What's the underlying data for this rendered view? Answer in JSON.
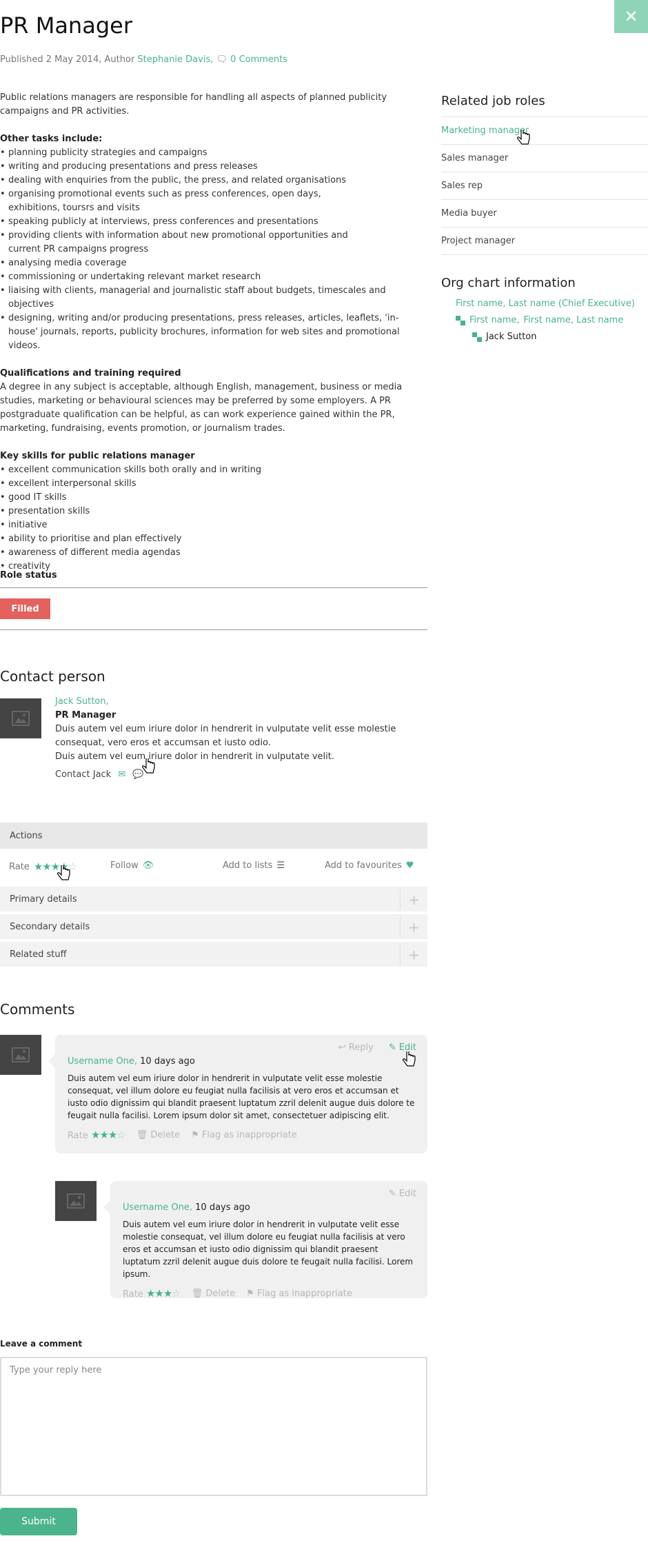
{
  "page": {
    "title": "PR Manager",
    "close_icon": "close-icon",
    "meta": {
      "published_prefix": "Published 2 May 2014, Author",
      "author": "Stephanie Davis,",
      "comments_link": "0 Comments",
      "comments_icon": "speech-bubbles-icon"
    }
  },
  "description": {
    "intro": "Public relations managers are responsible for handling all aspects of planned publicity campaigns and PR activities.",
    "tasks_heading": "Other tasks include:",
    "tasks": [
      "planning publicity strategies and campaigns",
      "writing and producing presentations and press releases",
      "dealing with enquiries from the public, the press, and related organisations",
      "organising promotional events such as press conferences, open days, exhibitions, toursrs and visits",
      "speaking publicly at interviews, press conferences and presentations",
      "providing clients with information about new promotional opportunities and current PR campaigns progress",
      "analysing media coverage",
      "commissioning or undertaking relevant market research",
      "liaising with clients, managerial and journalistic staff about budgets, timescales and objectives",
      "designing, writing and/or producing presentations, press releases, articles, leaflets, 'in-house' journals, reports, publicity brochures, information for web sites and promotional videos."
    ],
    "qualifications_heading": "Qualifications and training required",
    "qualifications_text": "A degree in any subject is acceptable, although English, management, business or media studies, marketing or behavioural sciences may be preferred by some employers. A PR postgraduate qualification can be helpful, as can work experience gained within the PR, marketing, fundraising, events promotion, or journalism trades.",
    "skills_heading": "Key skills for public relations manager",
    "skills": [
      "excellent communication skills both orally and in writing",
      "excellent interpersonal skills",
      "good IT skills",
      "presentation skills",
      "initiative",
      "ability to prioritise and plan effectively",
      "awareness of different media agendas",
      "creativity"
    ]
  },
  "role_status": {
    "label": "Role status",
    "badge": "Filled",
    "badge_color": "#e3625d"
  },
  "contact": {
    "title": "Contact person",
    "name": "Jack Sutton,",
    "role": "PR Manager",
    "text1": "Duis autem vel eum iriure dolor in hendrerit in vulputate velit esse molestie consequat, vero eros et accumsan et iusto odio.",
    "text2": "Duis autem vel eum iriure dolor in hendrerit in vulputate velit.",
    "contact_label": "Contact Jack",
    "icons": [
      "envelope-icon",
      "chat-icon"
    ]
  },
  "actions": {
    "header": "Actions",
    "rate_label": "Rate",
    "rating": 4,
    "rating_max": 5,
    "follow_label": "Follow",
    "add_to_lists_label": "Add to lists",
    "add_to_favourites_label": "Add to favourites",
    "accordion": [
      "Primary details",
      "Secondary details",
      "Related stuff"
    ]
  },
  "comments": {
    "title": "Comments",
    "items": [
      {
        "user": "Username One,",
        "when": "10 days ago",
        "text": "Duis autem vel eum iriure dolor in hendrerit in vulputate velit esse molestie consequat, vel illum dolore eu feugiat nulla facilisis at vero eros et accumsan et iusto odio dignissim qui blandit praesent luptatum zzril delenit augue duis dolore te feugait nulla facilisi. Lorem ipsum dolor sit amet, consectetuer adipiscing elit.",
        "reply_label": "Reply",
        "edit_label": "Edit",
        "rate_label": "Rate",
        "rating": 3,
        "delete_label": "Delete",
        "flag_label": "Flag as inappropriate"
      },
      {
        "user": "Username One,",
        "when": "10 days ago",
        "text": "Duis autem vel eum iriure dolor in hendrerit in vulputate velit esse molestie consequat, vel illum dolore eu feugiat nulla facilisis at vero eros et accumsan et iusto odio dignissim qui blandit praesent luptatum zzril delenit augue duis dolore te feugait nulla facilisi. Lorem ipsum.",
        "edit_label": "Edit",
        "rate_label": "Rate",
        "rating": 3,
        "delete_label": "Delete",
        "flag_label": "Flag as inappropriate"
      }
    ]
  },
  "reply_form": {
    "label": "Leave a comment",
    "placeholder": "Type your reply here",
    "submit": "Submit"
  },
  "sidebar": {
    "related_title": "Related job roles",
    "related": [
      "Marketing manager",
      "Sales manager",
      "Sales rep",
      "Media buyer",
      "Project manager"
    ],
    "org_title": "Org chart information",
    "org": {
      "level1": "First name, Last name (Chief Executive)",
      "level2a": "First name,",
      "level2b": "First name, Last name",
      "level3": "Jack Sutton"
    }
  },
  "colors": {
    "accent": "#49b38b",
    "status_filled": "#e3625d"
  }
}
